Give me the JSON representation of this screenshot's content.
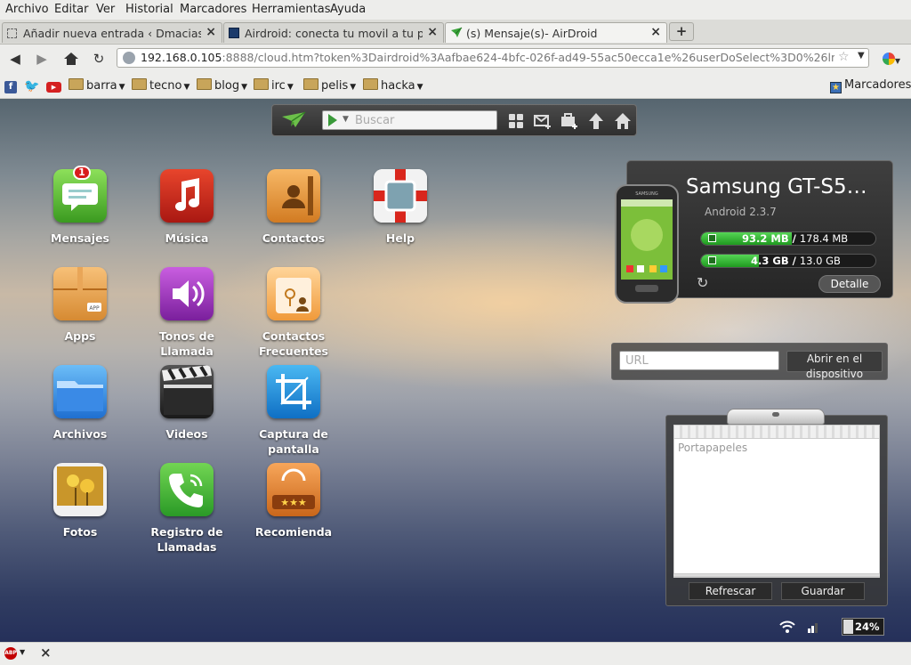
{
  "menu": [
    "Archivo",
    "Editar",
    "Ver",
    "Historial",
    "Marcadores",
    "Herramientas",
    "Ayuda"
  ],
  "tabs": [
    {
      "title": "Añadir nueva entrada ‹ Dmaciasblo…",
      "active": false
    },
    {
      "title": "Airdroid: conecta tu movil a tu pc",
      "active": false
    },
    {
      "title": "(s) Mensaje(s)- AirDroid",
      "active": true
    }
  ],
  "address": {
    "host": "192.168.0.105",
    "rest": ":8888/cloud.htm?token%3Dairdroid%3Aafbae624-4bfc-026f-ad49-55ac50ecca1e%26userDoSelect%3D0%26lng%3De"
  },
  "bookmarks": {
    "folders": [
      "barra",
      "tecno",
      "blog",
      "irc",
      "pelis",
      "hacka"
    ],
    "right_label": "Marcadores"
  },
  "toolbar": {
    "search_placeholder": "Buscar"
  },
  "apps": [
    {
      "label": "Mensajes",
      "badge": "1"
    },
    {
      "label": "Música"
    },
    {
      "label": "Contactos"
    },
    {
      "label": "Help"
    },
    {
      "label": "Apps"
    },
    {
      "label": "Tonos de Llamada"
    },
    {
      "label": "Contactos Frecuentes"
    },
    {
      "label": "Archivos"
    },
    {
      "label": "Videos"
    },
    {
      "label": "Captura de pantalla"
    },
    {
      "label": "Fotos"
    },
    {
      "label": "Registro de Llamadas"
    },
    {
      "label": "Recomienda"
    }
  ],
  "device": {
    "name": "Samsung GT-S5…",
    "os": "Android 2.3.7",
    "storage": [
      {
        "used": "93.2 MB",
        "total": "178.4 MB",
        "fraction": 0.52
      },
      {
        "used": "4.3 GB",
        "total": "13.0 GB",
        "fraction": 0.33
      }
    ],
    "detail_label": "Detalle"
  },
  "url_panel": {
    "placeholder": "URL",
    "button_label": "Abrir en el dispositivo"
  },
  "clipboard": {
    "placeholder": "Portapapeles",
    "refresh_label": "Refrescar",
    "save_label": "Guardar"
  },
  "status": {
    "battery": "24%",
    "battery_fraction": 0.24
  },
  "colors": {
    "accent_green": "#2fb52f",
    "badge_red": "#d81d1d"
  }
}
